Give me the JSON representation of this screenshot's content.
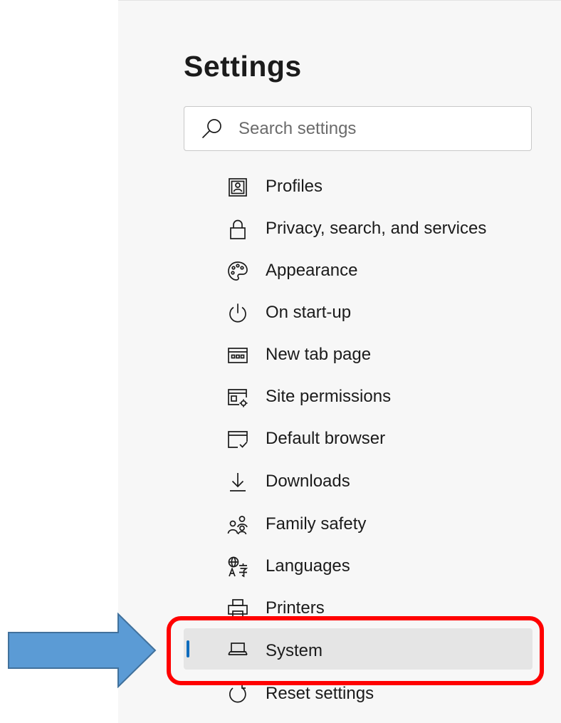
{
  "settings": {
    "title": "Settings",
    "search": {
      "placeholder": "Search settings",
      "value": ""
    },
    "nav_items": [
      {
        "label": "Profiles",
        "icon": "profile-icon"
      },
      {
        "label": "Privacy, search, and services",
        "icon": "lock-icon"
      },
      {
        "label": "Appearance",
        "icon": "palette-icon"
      },
      {
        "label": "On start-up",
        "icon": "power-icon"
      },
      {
        "label": "New tab page",
        "icon": "new-tab-icon"
      },
      {
        "label": "Site permissions",
        "icon": "site-permissions-icon"
      },
      {
        "label": "Default browser",
        "icon": "default-browser-icon"
      },
      {
        "label": "Downloads",
        "icon": "download-icon"
      },
      {
        "label": "Family safety",
        "icon": "family-icon"
      },
      {
        "label": "Languages",
        "icon": "languages-icon"
      },
      {
        "label": "Printers",
        "icon": "printer-icon"
      },
      {
        "label": "System",
        "icon": "laptop-icon",
        "selected": true
      },
      {
        "label": "Reset settings",
        "icon": "reset-icon"
      }
    ]
  },
  "colors": {
    "panel_background": "#f7f7f7",
    "selected_background": "#e5e5e5",
    "selected_indicator": "#0f6cbd",
    "highlight_box": "#ff0000",
    "arrow_fill": "#5b9bd5",
    "arrow_stroke": "#41719c"
  }
}
